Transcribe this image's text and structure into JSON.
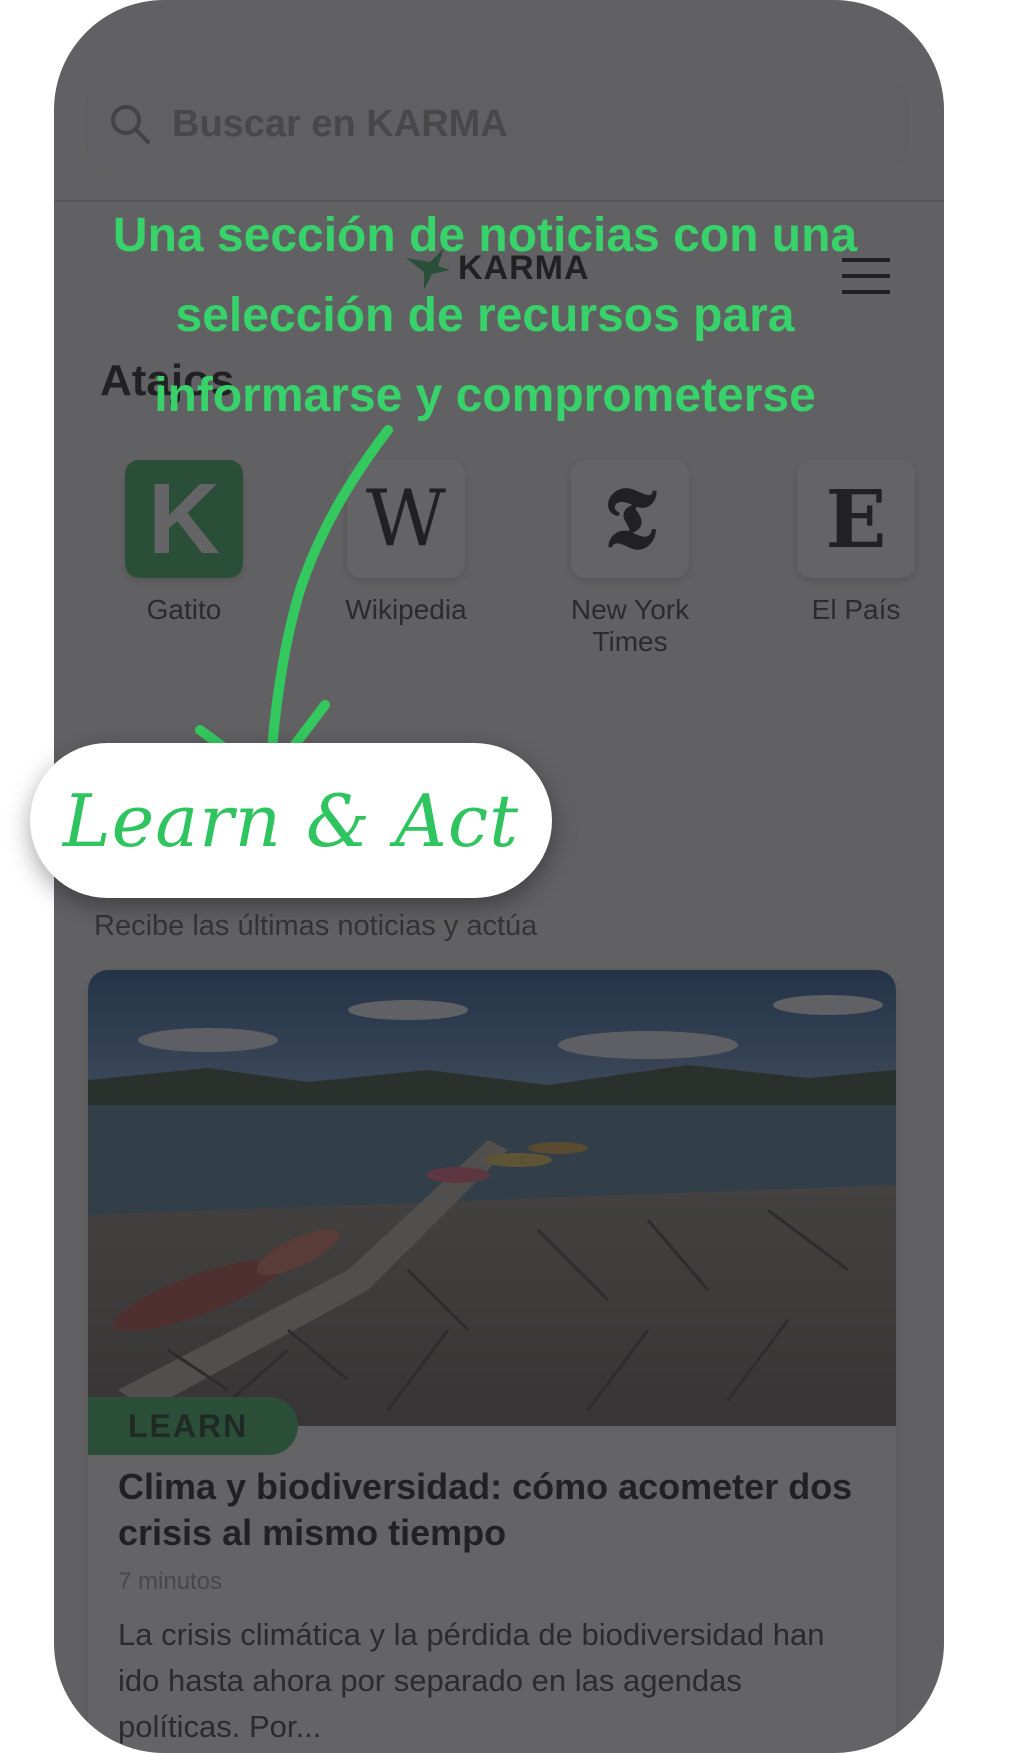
{
  "search": {
    "placeholder": "Buscar en KARMA"
  },
  "header": {
    "logo_text": "KARMA"
  },
  "shortcuts": {
    "title": "Atajos",
    "items": [
      {
        "label": "Gatito",
        "glyph": "K",
        "icon": "gatito-icon"
      },
      {
        "label": "Wikipedia",
        "glyph": "W",
        "icon": "wikipedia-icon"
      },
      {
        "label": "New York Times",
        "glyph": "𝕿",
        "icon": "nyt-icon"
      },
      {
        "label": "El País",
        "glyph": "E",
        "icon": "el-pais-icon"
      }
    ]
  },
  "news": {
    "subtitle": "Recibe las últimas noticias y actúa"
  },
  "card": {
    "badge": "LEARN",
    "title": "Clima y biodiversidad: cómo acometer dos crisis al mismo tiempo",
    "meta": "7 minutos",
    "description": "La crisis climática y la pérdida de biodiversidad han ido hasta ahora por separado en las agendas políticas. Por..."
  },
  "annotation": {
    "headline": "Una sección de noticias con una selección de recursos para informarse y comprometerse",
    "pill": "Learn & Act"
  },
  "colors": {
    "accent": "#37d36a",
    "overlay": "rgba(40,40,44,0.72)"
  }
}
